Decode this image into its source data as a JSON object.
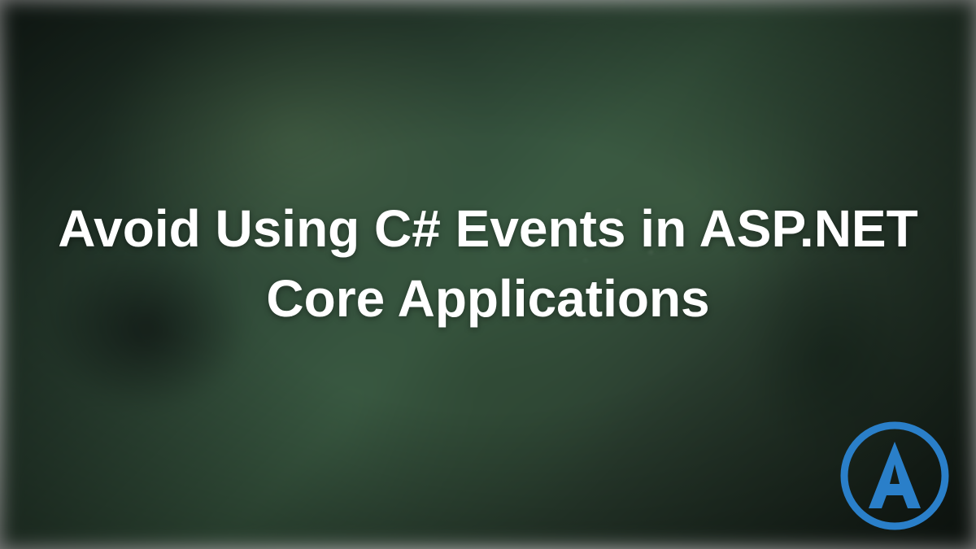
{
  "title": "Avoid Using C# Events in ASP.NET Core Applications",
  "logo": {
    "letter": "A",
    "color": "#2a7fc9"
  }
}
